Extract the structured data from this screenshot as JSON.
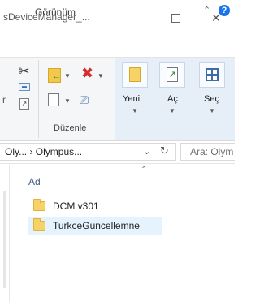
{
  "window": {
    "title": "sDeviceManager_...",
    "minimize_icon": "minimize-icon",
    "maximize_icon": "maximize-icon",
    "close_icon": "close-icon"
  },
  "ribbon_tabs": {
    "view_label": "Görünüm",
    "help_glyph": "?"
  },
  "ribbon": {
    "organize_group_label": "Düzenle",
    "new_label": "Yeni",
    "open_label": "Aç",
    "select_label": "Seç",
    "left_clip_letter": "r",
    "icons": [
      "scissors-icon",
      "copy-path-icon",
      "paste-shortcut-icon",
      "move-to-icon",
      "copy-to-icon",
      "delete-icon",
      "rename-icon",
      "new-folder-icon",
      "open-icon",
      "select-icon"
    ]
  },
  "address_bar": {
    "path": "Oly...  ›  Olympus...",
    "search_placeholder": "Ara: Olym"
  },
  "file_list": {
    "column_name": "Ad",
    "items": [
      {
        "name": "DCM v301",
        "type": "folder",
        "selected": false
      },
      {
        "name": "TurkceGuncellemne",
        "type": "folder",
        "selected": true
      }
    ]
  },
  "colors": {
    "accent": "#1a73e8",
    "selection": "#e5f3ff",
    "ribbon_highlight": "#e6eef8",
    "folder": "#f7d266",
    "delete_red": "#d32f2f"
  }
}
